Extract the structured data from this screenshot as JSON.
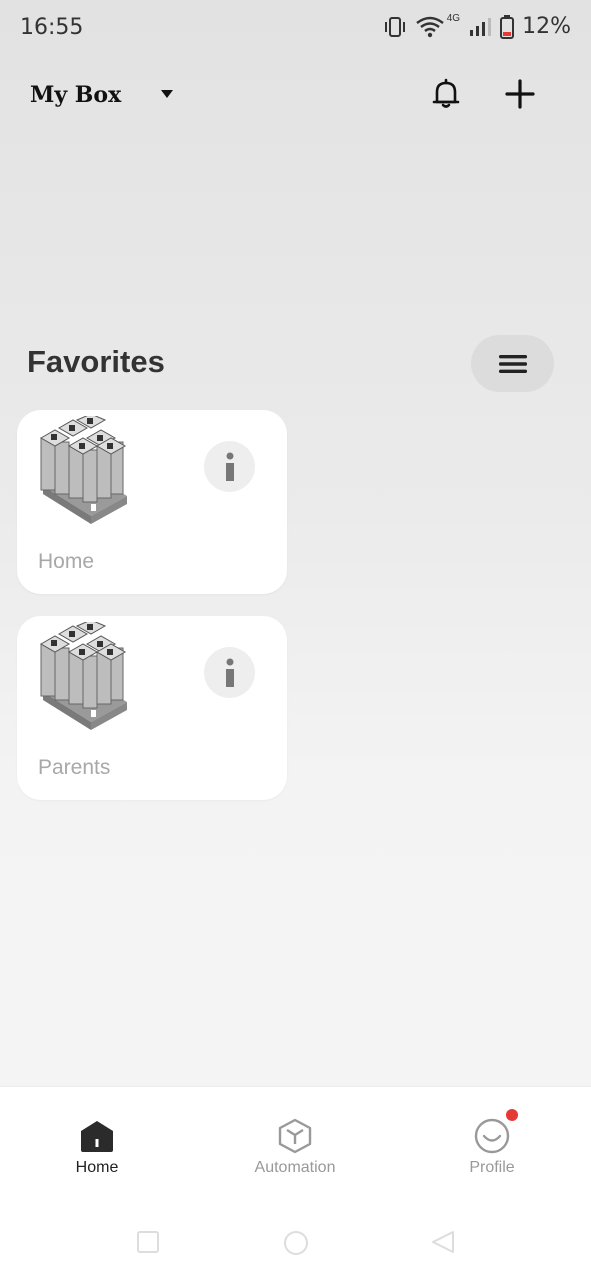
{
  "status": {
    "time": "16:55",
    "battery": "12%",
    "network": "4G"
  },
  "header": {
    "title": "My Box"
  },
  "favorites": {
    "title": "Favorites",
    "items": [
      {
        "label": "Home"
      },
      {
        "label": "Parents"
      }
    ]
  },
  "nav": {
    "items": [
      {
        "label": "Home",
        "icon": "home-icon",
        "active": true
      },
      {
        "label": "Automation",
        "icon": "cube-icon",
        "active": false
      },
      {
        "label": "Profile",
        "icon": "smile-icon",
        "active": false
      }
    ],
    "profile_badge_color": "#e53935"
  },
  "colors": {
    "accent_dark": "#222222",
    "inactive": "#999999"
  }
}
